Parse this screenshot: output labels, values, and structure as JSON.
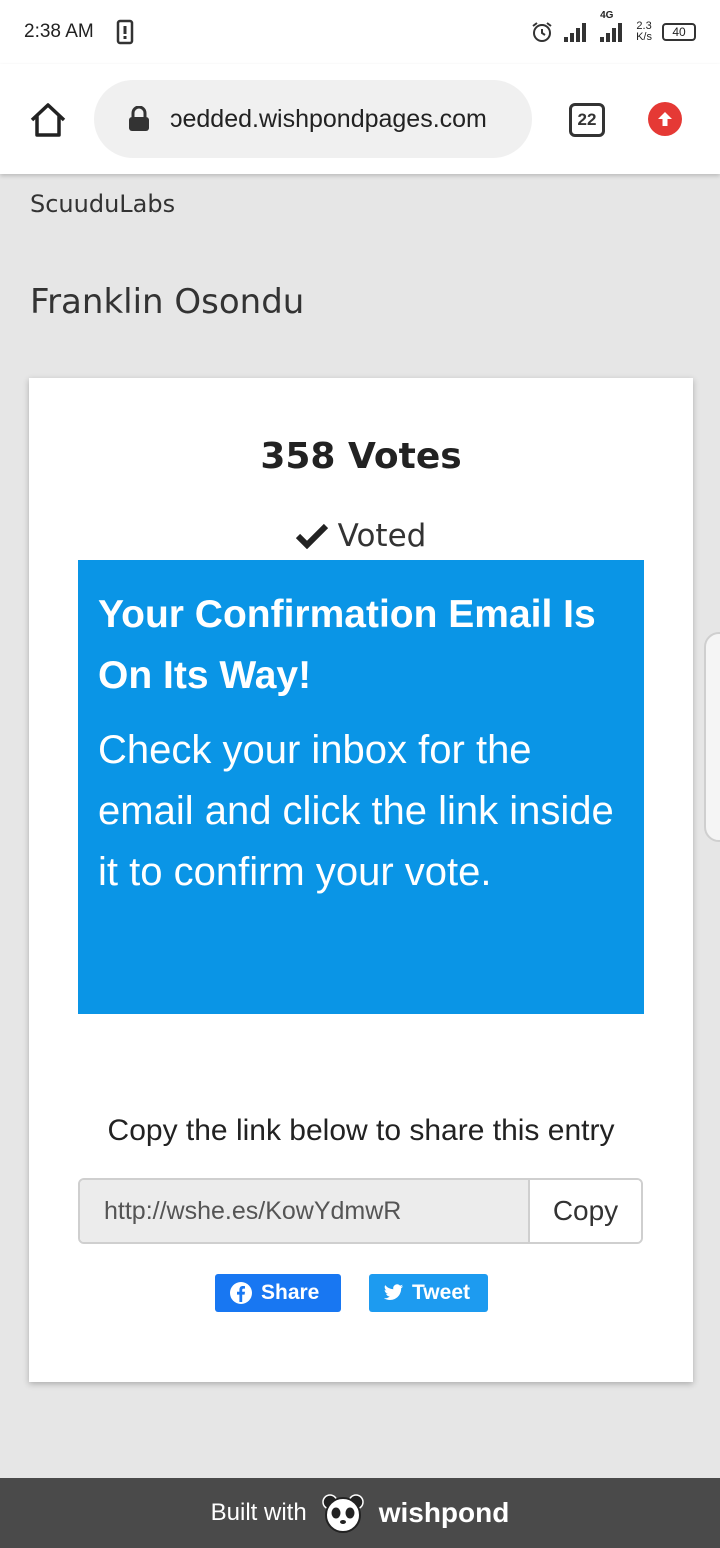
{
  "status_bar": {
    "time": "2:38 AM",
    "network": "4G",
    "speed_value": "2.3",
    "speed_unit": "K/s",
    "battery": "40"
  },
  "browser": {
    "url": "ɔedded.wishpondpages.com",
    "tab_count": "22"
  },
  "page": {
    "brand": "ScuuduLabs",
    "entrant_name": "Franklin Osondu"
  },
  "card": {
    "votes": "358 Votes",
    "voted_label": "Voted",
    "confirm_title": "Your Confirmation Email Is On Its Way!",
    "confirm_body": "Check your inbox for the email and click the link inside it to confirm your vote.",
    "share_caption": "Copy the link below to share this entry",
    "share_link": "http://wshe.es/KowYdmwR",
    "copy_label": "Copy",
    "facebook_label": "Share",
    "twitter_label": "Tweet"
  },
  "footer": {
    "built_with": "Built with",
    "brand": "wishpond"
  },
  "colors": {
    "accent_blue": "#0a95e6",
    "facebook": "#1877f2",
    "twitter": "#1d9bf0",
    "footer_bg": "#4a4a4a"
  }
}
